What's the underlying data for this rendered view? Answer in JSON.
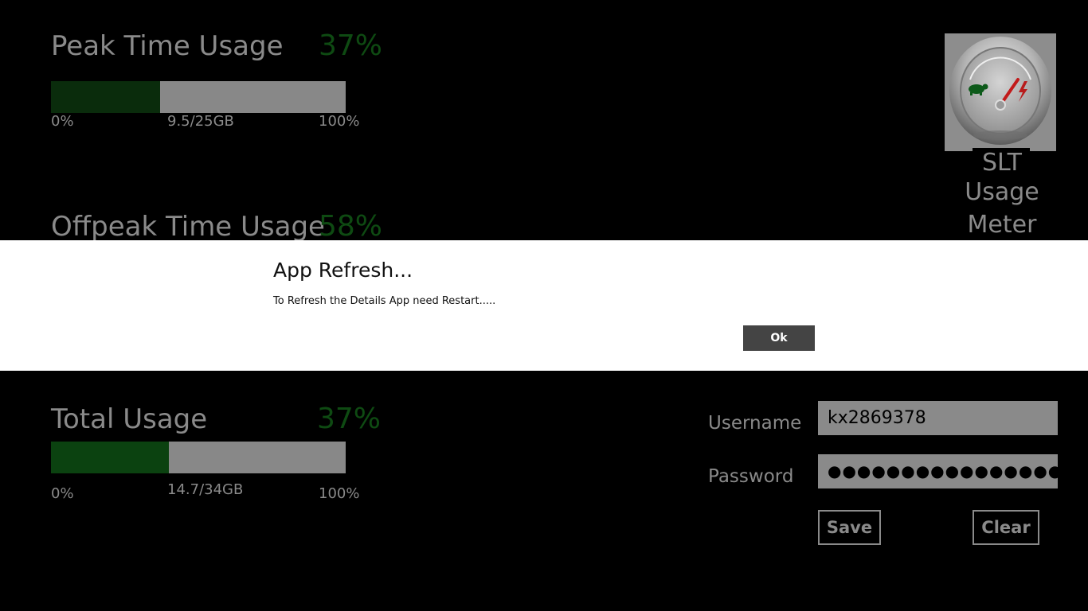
{
  "peak": {
    "title": "Peak Time Usage",
    "percent_label": "37%",
    "fill_fraction": 0.37,
    "min_label": "0%",
    "value_label": "9.5/25GB",
    "max_label": "100%"
  },
  "offpeak": {
    "title": "Offpeak Time Usage",
    "percent_label": "58%"
  },
  "total": {
    "title": "Total Usage",
    "percent_label": "37%",
    "fill_fraction": 0.4,
    "min_label": "0%",
    "value_label": "14.7/34GB",
    "max_label": "100%"
  },
  "logo": {
    "line1": "SLT",
    "line2": "Usage",
    "line3": "Meter",
    "icon": "speedometer-icon"
  },
  "login": {
    "username_label": "Username",
    "username_value": "kx2869378",
    "password_label": "Password",
    "password_mask": "●●●●●●●●●●●●●●●●",
    "save_label": "Save",
    "clear_label": "Clear"
  },
  "dialog": {
    "title": "App Refresh...",
    "message": "To Refresh the Details App need Restart.....",
    "ok_label": "Ok"
  },
  "colors": {
    "accent_green": "#0e4a12",
    "bar_track": "#888888",
    "text_gray": "#8a8a8a"
  }
}
